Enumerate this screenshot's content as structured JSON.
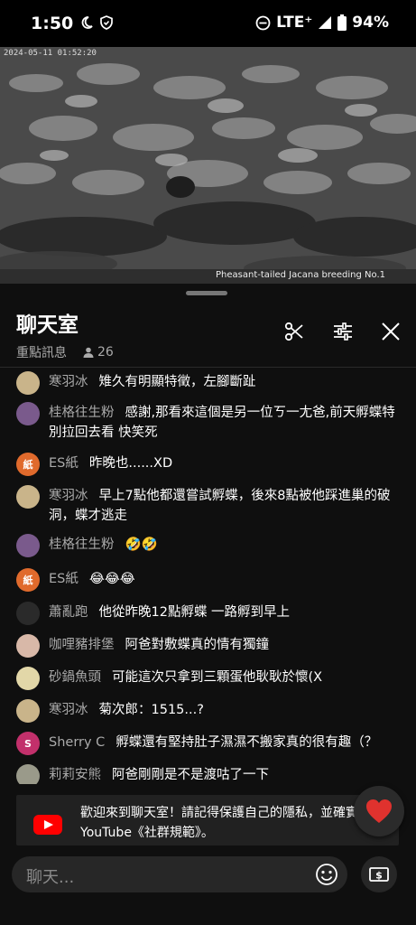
{
  "status_bar": {
    "time": "1:50",
    "network": "LTE⁺",
    "battery": "94%"
  },
  "video": {
    "timestamp": "2024-05-11 01:52:20",
    "caption": "Pheasant-tailed Jacana breeding No.1"
  },
  "chat": {
    "title": "聊天室",
    "mode": "重點訊息",
    "viewer_count": "26",
    "messages": [
      {
        "author": "寒羽冰",
        "text": "雉久有明顯特徵，左腳斷趾",
        "avatar_color": "#c9b48a",
        "avatar_letter": ""
      },
      {
        "author": "桂格往生粉",
        "text": "感謝,那看來這個是另一位ㄎ一尢爸,前天孵蝶特別拉回去看 快笑死",
        "avatar_color": "#7a5a8c",
        "avatar_letter": ""
      },
      {
        "author": "ES紙",
        "text": "昨晚也......XD",
        "avatar_color": "#e06a2c",
        "avatar_letter": "紙"
      },
      {
        "author": "寒羽冰",
        "text": "早上7點他都還嘗試孵蝶，後來8點被他踩進巢的破洞，蝶才逃走",
        "avatar_color": "#c9b48a",
        "avatar_letter": ""
      },
      {
        "author": "桂格往生粉",
        "text": "🤣🤣",
        "avatar_color": "#7a5a8c",
        "avatar_letter": ""
      },
      {
        "author": "ES紙",
        "text": "😂😂😂",
        "avatar_color": "#e06a2c",
        "avatar_letter": "紙"
      },
      {
        "author": "蕭亂跑",
        "text": "他從昨晚12點孵蝶 一路孵到早上",
        "avatar_color": "#2a2a2a",
        "avatar_letter": ""
      },
      {
        "author": "咖哩豬排堡",
        "text": "阿爸對敷蝶真的情有獨鐘",
        "avatar_color": "#d8b8a8",
        "avatar_letter": ""
      },
      {
        "author": "砂鍋魚頭",
        "text": "可能這次只拿到三顆蛋他耿耿於懷(X",
        "avatar_color": "#e2d7a8",
        "avatar_letter": ""
      },
      {
        "author": "寒羽冰",
        "text": "菊次郎：1515...?",
        "avatar_color": "#c9b48a",
        "avatar_letter": ""
      },
      {
        "author": "Sherry C",
        "text": "孵蝶還有堅持肚子濕濕不搬家真的很有趣（？",
        "avatar_color": "#c2306b",
        "avatar_letter": "S"
      },
      {
        "author": "莉莉安熊",
        "text": "阿爸剛剛是不是渡咕了一下",
        "avatar_color": "#9a9a8a",
        "avatar_letter": ""
      }
    ],
    "banner_text": "歡迎來到聊天室！請記得保護自己的隱私，並確實遵守 YouTube《社群規範》。",
    "input_placeholder": "聊天...",
    "dollar_label": "$"
  }
}
